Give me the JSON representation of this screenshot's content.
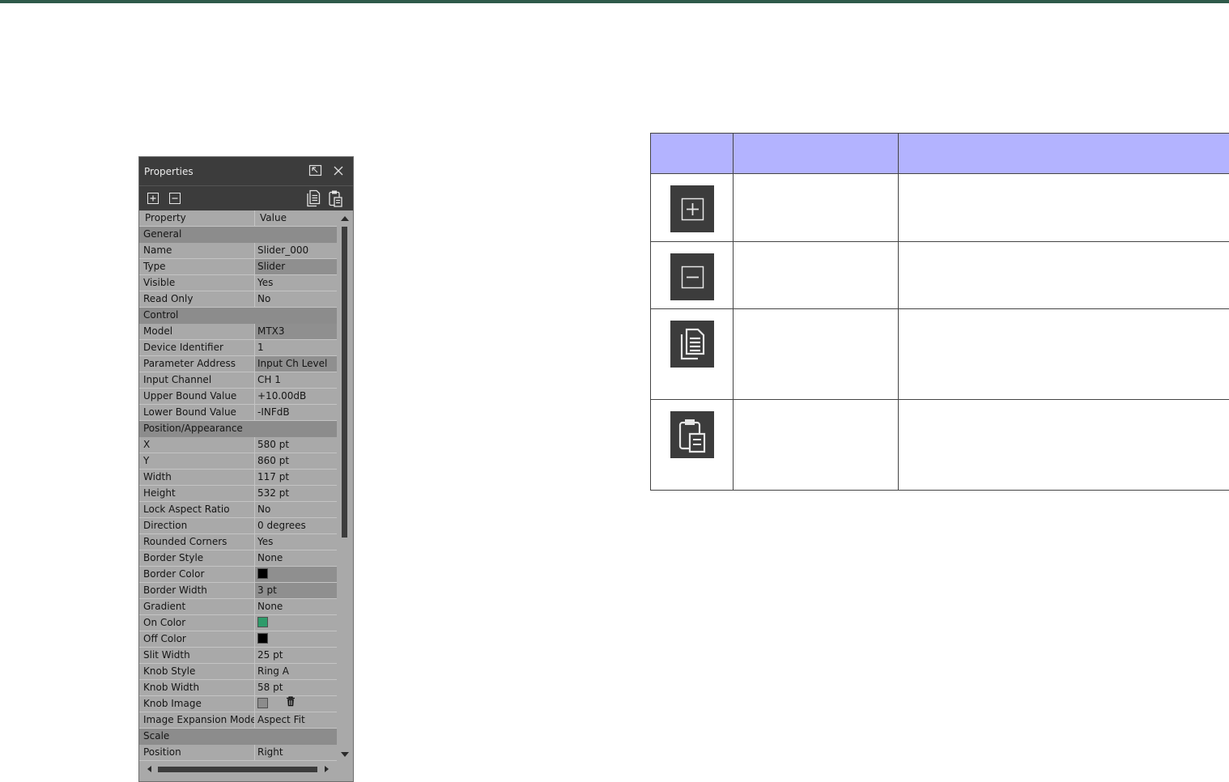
{
  "panel": {
    "title": "Properties",
    "toolbar": {
      "expand_icon": "expand-all-icon",
      "collapse_icon": "collapse-all-icon",
      "copy_icon": "copy-icon",
      "paste_icon": "paste-icon"
    },
    "header": {
      "property": "Property",
      "value": "Value"
    },
    "rows": [
      {
        "kind": "cat",
        "label": "General"
      },
      {
        "kind": "prop",
        "label": "Name",
        "value": "Slider_000"
      },
      {
        "kind": "prop",
        "label": "Type",
        "value": "Slider",
        "readonly": true
      },
      {
        "kind": "prop",
        "label": "Visible",
        "value": "Yes"
      },
      {
        "kind": "prop",
        "label": "Read Only",
        "value": "No"
      },
      {
        "kind": "cat",
        "label": "Control"
      },
      {
        "kind": "prop",
        "label": "Model",
        "value": "MTX3",
        "readonly": true
      },
      {
        "kind": "prop",
        "label": "Device Identifier",
        "value": "1"
      },
      {
        "kind": "prop",
        "label": "Parameter Address",
        "value": "Input Ch Level",
        "readonly": true
      },
      {
        "kind": "prop",
        "label": "Input Channel",
        "value": "CH 1"
      },
      {
        "kind": "prop",
        "label": "Upper Bound Value",
        "value": "+10.00dB"
      },
      {
        "kind": "prop",
        "label": "Lower Bound Value",
        "value": "-INFdB"
      },
      {
        "kind": "cat",
        "label": "Position/Appearance"
      },
      {
        "kind": "prop",
        "label": "X",
        "value": "580 pt"
      },
      {
        "kind": "prop",
        "label": "Y",
        "value": "860 pt"
      },
      {
        "kind": "prop",
        "label": "Width",
        "value": "117 pt"
      },
      {
        "kind": "prop",
        "label": "Height",
        "value": "532 pt"
      },
      {
        "kind": "prop",
        "label": "Lock Aspect Ratio",
        "value": "No"
      },
      {
        "kind": "prop",
        "label": "Direction",
        "value": "0 degrees"
      },
      {
        "kind": "prop",
        "label": "Rounded Corners",
        "value": "Yes"
      },
      {
        "kind": "prop",
        "label": "Border Style",
        "value": "None"
      },
      {
        "kind": "color",
        "label": "Border Color",
        "color": "#000000",
        "readonly": true
      },
      {
        "kind": "prop",
        "label": "Border Width",
        "value": "3 pt",
        "readonly": true
      },
      {
        "kind": "prop",
        "label": "Gradient",
        "value": "None"
      },
      {
        "kind": "color",
        "label": "On Color",
        "color": "#2e9b6a"
      },
      {
        "kind": "color",
        "label": "Off Color",
        "color": "#000000"
      },
      {
        "kind": "prop",
        "label": "Slit Width",
        "value": "25 pt"
      },
      {
        "kind": "prop",
        "label": "Knob Style",
        "value": "Ring A"
      },
      {
        "kind": "prop",
        "label": "Knob Width",
        "value": "58 pt"
      },
      {
        "kind": "image",
        "label": "Knob Image",
        "color": "#8c8c8c",
        "icon": "trash-icon"
      },
      {
        "kind": "prop",
        "label": "Image Expansion Mode",
        "value": "Aspect Fit"
      },
      {
        "kind": "cat",
        "label": "Scale"
      },
      {
        "kind": "prop",
        "label": "Position",
        "value": "Right"
      }
    ]
  },
  "reference_table": {
    "header_color": "#b3b3ff",
    "headers": [
      "",
      "",
      ""
    ],
    "rows": [
      {
        "icon": "expand-all-icon",
        "name": "",
        "description": ""
      },
      {
        "icon": "collapse-all-icon",
        "name": "",
        "description": ""
      },
      {
        "icon": "copy-icon",
        "name": "",
        "description": ""
      },
      {
        "icon": "paste-icon",
        "name": "",
        "description": ""
      }
    ]
  },
  "colors": {
    "top_bar": "#2f5a4a",
    "panel_chrome": "#3c3c3c",
    "panel_body": "#a9a9a9",
    "category_row": "#8c8c8c"
  }
}
